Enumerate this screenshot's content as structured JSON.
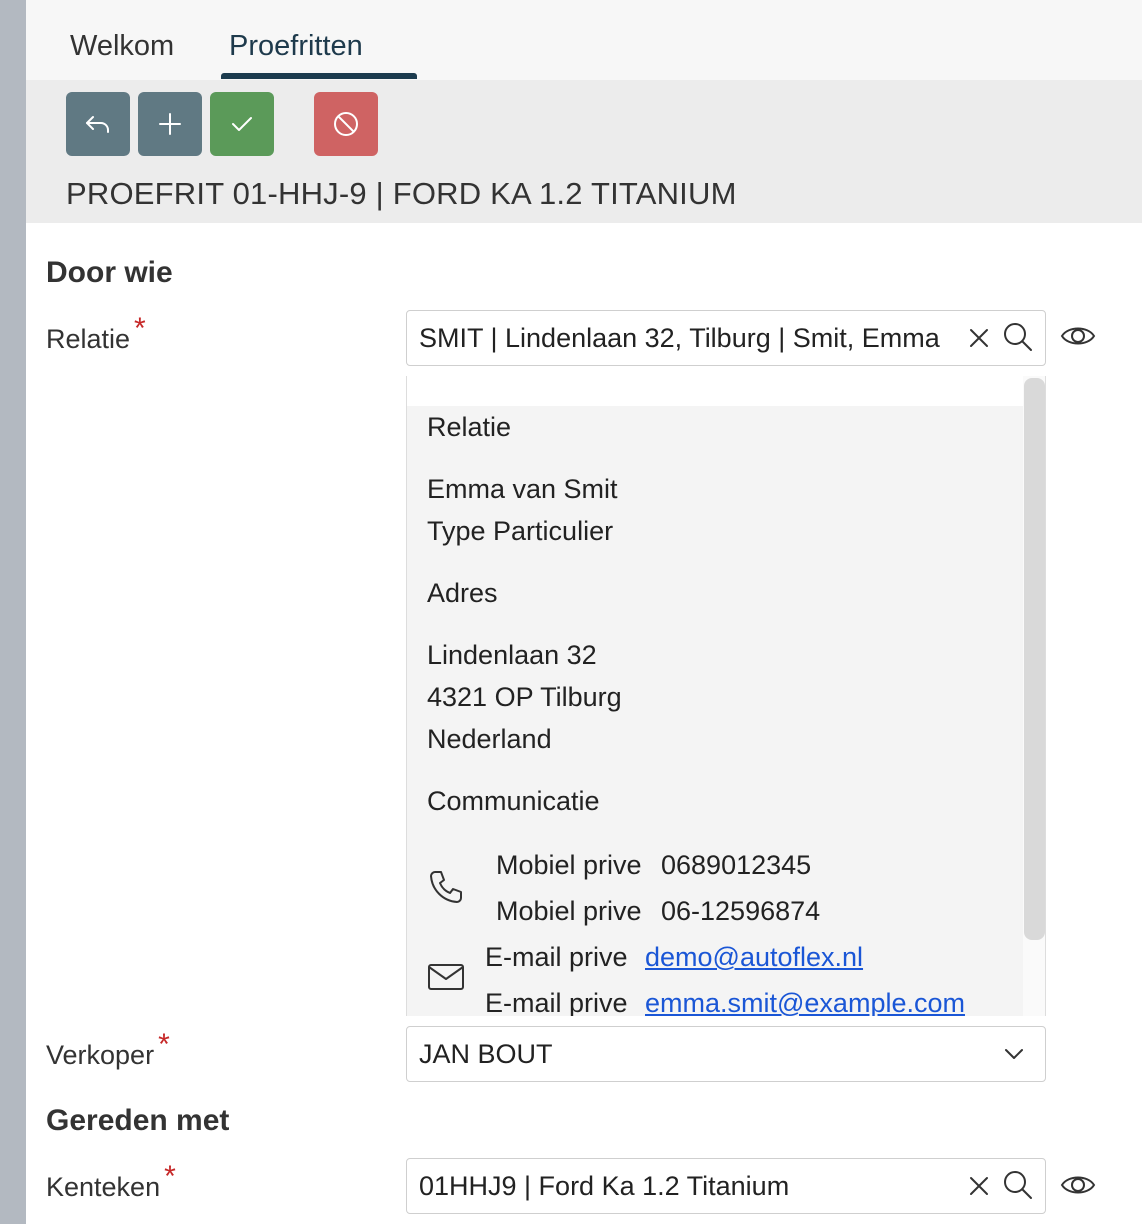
{
  "tabs": [
    {
      "label": "Welkom",
      "active": false
    },
    {
      "label": "Proefritten",
      "active": true
    }
  ],
  "toolbar": {
    "buttons": [
      {
        "name": "back",
        "icon": "undo-arrow-icon",
        "color": "#607983"
      },
      {
        "name": "add",
        "icon": "plus-icon",
        "color": "#607983"
      },
      {
        "name": "save",
        "icon": "check-icon",
        "color": "#5b9a59"
      },
      {
        "name": "cancel",
        "icon": "prohibited-icon",
        "color": "#cf6363"
      }
    ],
    "title": "PROEFRIT 01-HHJ-9 | FORD KA 1.2 TITANIUM"
  },
  "sections": {
    "door_wie": "Door wie",
    "gereden_met": "Gereden met"
  },
  "fields": {
    "relatie": {
      "label": "Relatie",
      "required_mark": "*",
      "value": "SMIT  | Lindenlaan 32, Tilburg | Smit, Emma"
    },
    "verkoper": {
      "label": "Verkoper",
      "required_mark": "*",
      "value": "JAN BOUT"
    },
    "kenteken": {
      "label": "Kenteken",
      "required_mark": "*",
      "value": "01HHJ9 | Ford Ka 1.2 Titanium"
    }
  },
  "relatie_popup": {
    "heading": "Relatie",
    "name": "Emma van Smit",
    "type": "Type Particulier",
    "address_heading": "Adres",
    "street": "Lindenlaan 32",
    "postal_city": "4321 OP Tilburg",
    "country": "Nederland",
    "communication_heading": "Communicatie",
    "phones": [
      {
        "label": "Mobiel prive",
        "value": "0689012345"
      },
      {
        "label": "Mobiel prive",
        "value": "06-12596874"
      }
    ],
    "emails": [
      {
        "label": "E-mail prive",
        "value": "demo@autoflex.nl"
      },
      {
        "label": "E-mail prive",
        "value": "emma.smit@example.com"
      }
    ]
  }
}
